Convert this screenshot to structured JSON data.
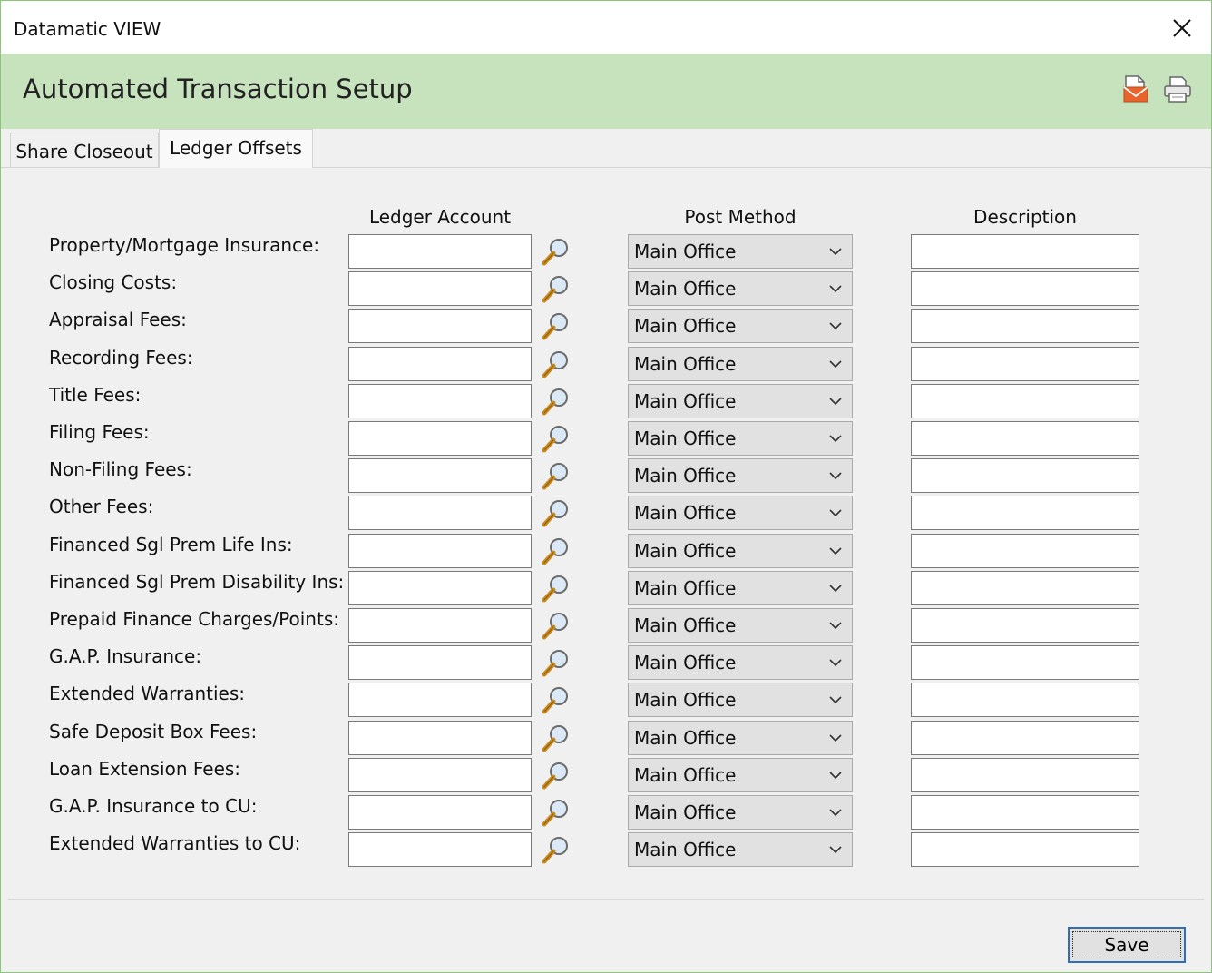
{
  "window": {
    "title": "Datamatic VIEW",
    "close_icon": "close-icon"
  },
  "header": {
    "title": "Automated Transaction Setup",
    "icons": [
      "envelope-export-icon",
      "printer-icon"
    ]
  },
  "tabs": [
    {
      "label": "Share Closeout",
      "active": false
    },
    {
      "label": "Ledger Offsets",
      "active": true
    }
  ],
  "columns": {
    "ledger": "Ledger Account",
    "post": "Post Method",
    "description": "Description"
  },
  "rows": [
    {
      "label": "Property/Mortgage Insurance:",
      "ledger": "",
      "post": "Main Office",
      "description": ""
    },
    {
      "label": "Closing Costs:",
      "ledger": "",
      "post": "Main Office",
      "description": ""
    },
    {
      "label": "Appraisal Fees:",
      "ledger": "",
      "post": "Main Office",
      "description": ""
    },
    {
      "label": "Recording Fees:",
      "ledger": "",
      "post": "Main Office",
      "description": ""
    },
    {
      "label": "Title Fees:",
      "ledger": "",
      "post": "Main Office",
      "description": ""
    },
    {
      "label": "Filing Fees:",
      "ledger": "",
      "post": "Main Office",
      "description": ""
    },
    {
      "label": "Non-Filing Fees:",
      "ledger": "",
      "post": "Main Office",
      "description": ""
    },
    {
      "label": "Other Fees:",
      "ledger": "",
      "post": "Main Office",
      "description": ""
    },
    {
      "label": "Financed Sgl Prem Life Ins:",
      "ledger": "",
      "post": "Main Office",
      "description": ""
    },
    {
      "label": "Financed Sgl Prem Disability Ins:",
      "ledger": "",
      "post": "Main Office",
      "description": ""
    },
    {
      "label": "Prepaid Finance Charges/Points:",
      "ledger": "",
      "post": "Main Office",
      "description": ""
    },
    {
      "label": "G.A.P. Insurance:",
      "ledger": "",
      "post": "Main Office",
      "description": ""
    },
    {
      "label": "Extended Warranties:",
      "ledger": "",
      "post": "Main Office",
      "description": ""
    },
    {
      "label": "Safe Deposit Box Fees:",
      "ledger": "",
      "post": "Main Office",
      "description": ""
    },
    {
      "label": "Loan Extension Fees:",
      "ledger": "",
      "post": "Main Office",
      "description": ""
    },
    {
      "label": "G.A.P. Insurance to CU:",
      "ledger": "",
      "post": "Main Office",
      "description": ""
    },
    {
      "label": "Extended Warranties to CU:",
      "ledger": "",
      "post": "Main Office",
      "description": ""
    }
  ],
  "footer": {
    "save_label": "Save"
  }
}
